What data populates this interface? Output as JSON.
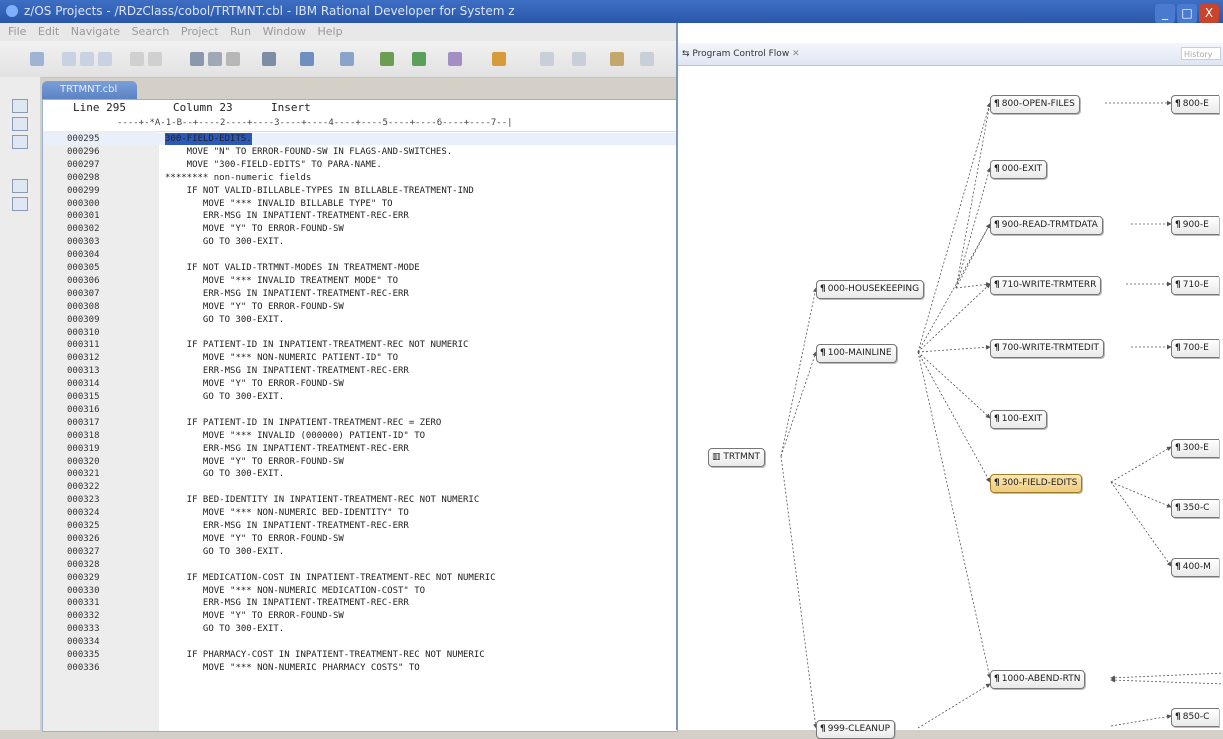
{
  "window": {
    "title": "z/OS Projects - /RDzClass/cobol/TRTMNT.cbl - IBM Rational Developer for System z",
    "buttons": [
      "_",
      "□",
      "X"
    ]
  },
  "menubar": [
    "File",
    "Edit",
    "Navigate",
    "Search",
    "Project",
    "Run",
    "Window",
    "Help"
  ],
  "editor": {
    "tab_label": "TRTMNT.cbl",
    "status": {
      "line": "Line 295",
      "column": "Column 23",
      "mode": "Insert"
    },
    "ruler": "----+-*A-1-B--+----2----+----3----+----4----+----5----+----6----+----7--|",
    "lines": [
      {
        "num": "000295",
        "code": "300-FIELD-EDITS."
      },
      {
        "num": "000296",
        "code": "    MOVE \"N\" TO ERROR-FOUND-SW IN FLAGS-AND-SWITCHES."
      },
      {
        "num": "000297",
        "code": "    MOVE \"300-FIELD-EDITS\" TO PARA-NAME."
      },
      {
        "num": "000298",
        "code": "******** non-numeric fields"
      },
      {
        "num": "000299",
        "code": "    IF NOT VALID-BILLABLE-TYPES IN BILLABLE-TREATMENT-IND"
      },
      {
        "num": "000300",
        "code": "       MOVE \"*** INVALID BILLABLE TYPE\" TO"
      },
      {
        "num": "000301",
        "code": "       ERR-MSG IN INPATIENT-TREATMENT-REC-ERR"
      },
      {
        "num": "000302",
        "code": "       MOVE \"Y\" TO ERROR-FOUND-SW"
      },
      {
        "num": "000303",
        "code": "       GO TO 300-EXIT."
      },
      {
        "num": "000304",
        "code": ""
      },
      {
        "num": "000305",
        "code": "    IF NOT VALID-TRTMNT-MODES IN TREATMENT-MODE"
      },
      {
        "num": "000306",
        "code": "       MOVE \"*** INVALID TREATMENT MODE\" TO"
      },
      {
        "num": "000307",
        "code": "       ERR-MSG IN INPATIENT-TREATMENT-REC-ERR"
      },
      {
        "num": "000308",
        "code": "       MOVE \"Y\" TO ERROR-FOUND-SW"
      },
      {
        "num": "000309",
        "code": "       GO TO 300-EXIT."
      },
      {
        "num": "000310",
        "code": ""
      },
      {
        "num": "000311",
        "code": "    IF PATIENT-ID IN INPATIENT-TREATMENT-REC NOT NUMERIC"
      },
      {
        "num": "000312",
        "code": "       MOVE \"*** NON-NUMERIC PATIENT-ID\" TO"
      },
      {
        "num": "000313",
        "code": "       ERR-MSG IN INPATIENT-TREATMENT-REC-ERR"
      },
      {
        "num": "000314",
        "code": "       MOVE \"Y\" TO ERROR-FOUND-SW"
      },
      {
        "num": "000315",
        "code": "       GO TO 300-EXIT."
      },
      {
        "num": "000316",
        "code": ""
      },
      {
        "num": "000317",
        "code": "    IF PATIENT-ID IN INPATIENT-TREATMENT-REC = ZERO"
      },
      {
        "num": "000318",
        "code": "       MOVE \"*** INVALID (000000) PATIENT-ID\" TO"
      },
      {
        "num": "000319",
        "code": "       ERR-MSG IN INPATIENT-TREATMENT-REC-ERR"
      },
      {
        "num": "000320",
        "code": "       MOVE \"Y\" TO ERROR-FOUND-SW"
      },
      {
        "num": "000321",
        "code": "       GO TO 300-EXIT."
      },
      {
        "num": "000322",
        "code": ""
      },
      {
        "num": "000323",
        "code": "    IF BED-IDENTITY IN INPATIENT-TREATMENT-REC NOT NUMERIC"
      },
      {
        "num": "000324",
        "code": "       MOVE \"*** NON-NUMERIC BED-IDENTITY\" TO"
      },
      {
        "num": "000325",
        "code": "       ERR-MSG IN INPATIENT-TREATMENT-REC-ERR"
      },
      {
        "num": "000326",
        "code": "       MOVE \"Y\" TO ERROR-FOUND-SW"
      },
      {
        "num": "000327",
        "code": "       GO TO 300-EXIT."
      },
      {
        "num": "000328",
        "code": ""
      },
      {
        "num": "000329",
        "code": "    IF MEDICATION-COST IN INPATIENT-TREATMENT-REC NOT NUMERIC"
      },
      {
        "num": "000330",
        "code": "       MOVE \"*** NON-NUMERIC MEDICATION-COST\" TO"
      },
      {
        "num": "000331",
        "code": "       ERR-MSG IN INPATIENT-TREATMENT-REC-ERR"
      },
      {
        "num": "000332",
        "code": "       MOVE \"Y\" TO ERROR-FOUND-SW"
      },
      {
        "num": "000333",
        "code": "       GO TO 300-EXIT."
      },
      {
        "num": "000334",
        "code": ""
      },
      {
        "num": "000335",
        "code": "    IF PHARMACY-COST IN INPATIENT-TREATMENT-REC NOT NUMERIC"
      },
      {
        "num": "000336",
        "code": "       MOVE \"*** NON-NUMERIC PHARMACY COSTS\" TO"
      }
    ]
  },
  "control_flow": {
    "tab_label": "Program Control Flow",
    "history_label": "History",
    "root": "TRTMNT",
    "nodes": {
      "housekeeping": "000-HOUSEKEEPING",
      "mainline": "100-MAINLINE",
      "cleanup": "999-CLEANUP",
      "open_files": "800-OPEN-FILES",
      "exit_000": "000-EXIT",
      "read_trmtdata": "900-READ-TRMTDATA",
      "write_trmterr": "710-WRITE-TRMTERR",
      "write_trmtedit": "700-WRITE-TRMTEDIT",
      "exit_100": "100-EXIT",
      "field_edits": "300-FIELD-EDITS",
      "abend_rtn": "1000-ABEND-RTN",
      "cut_800": "800-E",
      "cut_900": "900-E",
      "cut_710": "710-E",
      "cut_700": "700-E",
      "cut_300": "300-E",
      "cut_350": "350-C",
      "cut_400": "400-M",
      "cut_850": "850-C"
    }
  }
}
